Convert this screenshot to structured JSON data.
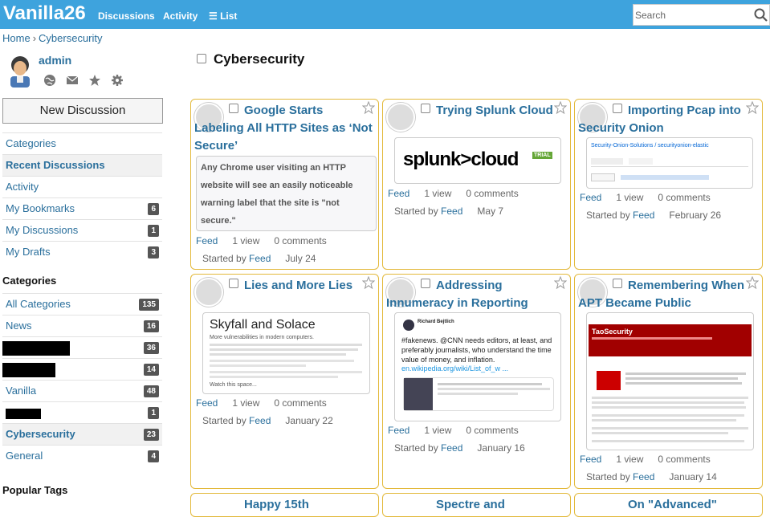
{
  "header": {
    "logo": "Vanilla26",
    "nav": [
      "Discussions",
      "Activity",
      "List"
    ],
    "search_placeholder": "Search"
  },
  "breadcrumb": {
    "home": "Home",
    "sep": "›",
    "current": "Cybersecurity"
  },
  "user": {
    "name": "admin"
  },
  "sidebar": {
    "new_discussion": "New Discussion",
    "menu": [
      {
        "label": "Categories",
        "count": null
      },
      {
        "label": "Recent Discussions",
        "count": null
      },
      {
        "label": "Activity",
        "count": null
      },
      {
        "label": "My Bookmarks",
        "count": "6"
      },
      {
        "label": "My Discussions",
        "count": "1"
      },
      {
        "label": "My Drafts",
        "count": "3"
      }
    ],
    "categories_heading": "Categories",
    "categories": [
      {
        "label": "All Categories",
        "count": "135"
      },
      {
        "label": "News",
        "count": "16"
      },
      {
        "label": "",
        "count": "36"
      },
      {
        "label": "",
        "count": "14"
      },
      {
        "label": "Vanilla",
        "count": "48"
      },
      {
        "label": "",
        "count": "1"
      },
      {
        "label": "Cybersecurity",
        "count": "23"
      },
      {
        "label": "General",
        "count": "4"
      }
    ],
    "tags_heading": "Popular Tags"
  },
  "page": {
    "title": "Cybersecurity"
  },
  "cards": [
    {
      "title": "Google Starts Labeling All HTTP Sites as ‘Not Secure’",
      "excerpt": "Any Chrome user visiting an HTTP website will see an easily noticeable warning label that the site is \"not secure.\"",
      "feed": "Feed",
      "views": "1 view",
      "comments": "0 comments",
      "started": "Started by",
      "by": "Feed",
      "date": "July 24"
    },
    {
      "title": "Trying Splunk Cloud",
      "preview_text": "splunk>cloud",
      "preview_badge": "TRIAL",
      "feed": "Feed",
      "views": "1 view",
      "comments": "0 comments",
      "started": "Started by",
      "by": "Feed",
      "date": "May 7"
    },
    {
      "title": "Importing Pcap into Security Onion",
      "preview_text": "Security-Onion-Solutions / securityonion-elastic",
      "feed": "Feed",
      "views": "1 view",
      "comments": "0 comments",
      "started": "Started by",
      "by": "Feed",
      "date": "February 26"
    },
    {
      "title": "Lies and More Lies",
      "preview_text": "Skyfall and Solace",
      "preview_sub": "More vulnerabilities in modern computers.",
      "preview_more": "Watch this space...",
      "feed": "Feed",
      "views": "1 view",
      "comments": "0 comments",
      "started": "Started by",
      "by": "Feed",
      "date": "January 22"
    },
    {
      "title": "Addressing Innumeracy in Reporting",
      "tweet_author": "Richard Bejtlich",
      "tweet_text": "#fakenews. @CNN needs editors, at least, and preferably journalists, who understand the time value of money, and inflation.",
      "tweet_link": "en.wikipedia.org/wiki/List_of_w ...",
      "feed": "Feed",
      "views": "1 view",
      "comments": "0 comments",
      "started": "Started by",
      "by": "Feed",
      "date": "January 16"
    },
    {
      "title": "Remembering When APT Became Public",
      "preview_text": "TaoSecurity",
      "feed": "Feed",
      "views": "1 view",
      "comments": "0 comments",
      "started": "Started by",
      "by": "Feed",
      "date": "January 14"
    },
    {
      "title": "Happy 15th"
    },
    {
      "title": "Spectre and"
    },
    {
      "title": "On \"Advanced\""
    }
  ],
  "colors": {
    "accent": "#3ea3dd",
    "link": "#2a6f9c",
    "card_border": "#e3b93b"
  }
}
